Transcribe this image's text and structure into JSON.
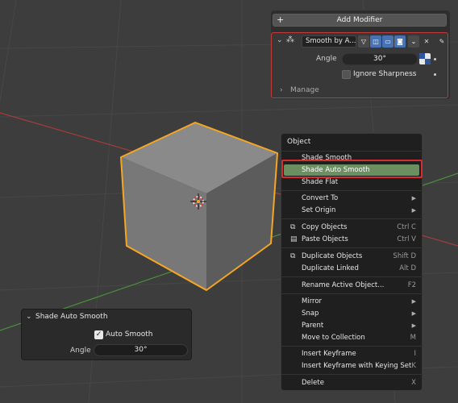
{
  "modifier": {
    "add_label": "Add Modifier",
    "plus_icon": "+",
    "name": "Smooth by A...",
    "angle_label": "Angle",
    "angle_value": "30°",
    "ignore_sharpness_label": "Ignore Sharpness",
    "ignore_sharpness_checked": false,
    "manage_label": "Manage",
    "border_color": "#c23b3b"
  },
  "context_menu": {
    "title": "Object",
    "highlight_color": "#6b8f61",
    "items": [
      {
        "label": "Shade Smooth",
        "shortcut": "",
        "submenu": false,
        "icon": ""
      },
      {
        "label": "Shade Auto Smooth",
        "shortcut": "",
        "submenu": false,
        "icon": "",
        "highlighted": true
      },
      {
        "label": "Shade Flat",
        "shortcut": "",
        "submenu": false,
        "icon": ""
      },
      {
        "label": "Convert To",
        "shortcut": "",
        "submenu": true,
        "icon": ""
      },
      {
        "label": "Set Origin",
        "shortcut": "",
        "submenu": true,
        "icon": ""
      },
      {
        "label": "Copy Objects",
        "shortcut": "Ctrl C",
        "submenu": false,
        "icon": "copy-icon"
      },
      {
        "label": "Paste Objects",
        "shortcut": "Ctrl V",
        "submenu": false,
        "icon": "paste-icon"
      },
      {
        "label": "Duplicate Objects",
        "shortcut": "Shift D",
        "submenu": false,
        "icon": "duplicate-icon"
      },
      {
        "label": "Duplicate Linked",
        "shortcut": "Alt D",
        "submenu": false,
        "icon": ""
      },
      {
        "label": "Rename Active Object...",
        "shortcut": "F2",
        "submenu": false,
        "icon": ""
      },
      {
        "label": "Mirror",
        "shortcut": "",
        "submenu": true,
        "icon": ""
      },
      {
        "label": "Snap",
        "shortcut": "",
        "submenu": true,
        "icon": ""
      },
      {
        "label": "Parent",
        "shortcut": "",
        "submenu": true,
        "icon": ""
      },
      {
        "label": "Move to Collection",
        "shortcut": "M",
        "submenu": false,
        "icon": ""
      },
      {
        "label": "Insert Keyframe",
        "shortcut": "I",
        "submenu": false,
        "icon": ""
      },
      {
        "label": "Insert Keyframe with Keying Set",
        "shortcut": "K",
        "submenu": false,
        "icon": ""
      },
      {
        "label": "Delete",
        "shortcut": "X",
        "submenu": false,
        "icon": ""
      }
    ]
  },
  "operation_panel": {
    "title": "Shade Auto Smooth",
    "auto_smooth_label": "Auto Smooth",
    "auto_smooth_checked": true,
    "angle_label": "Angle",
    "angle_value": "30°"
  },
  "viewport": {
    "background": "#3d3d3d",
    "cube_outline_color": "#f5a623",
    "x_axis_color": "#a43c3c",
    "y_axis_color": "#4a8f3a"
  }
}
